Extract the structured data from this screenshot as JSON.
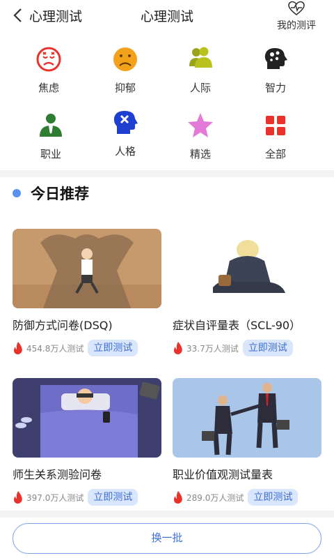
{
  "header": {
    "back_label": "心理测试",
    "title": "心理测试",
    "my_test_label": "我的测评"
  },
  "categories": [
    {
      "label": "焦虑",
      "icon": "anxious-face-icon",
      "color": "#e8322b"
    },
    {
      "label": "抑郁",
      "icon": "sad-face-icon",
      "color": "#f3a21b"
    },
    {
      "label": "人际",
      "icon": "people-icon",
      "color": "#b9c21c"
    },
    {
      "label": "智力",
      "icon": "brain-head-icon",
      "color": "#222222"
    },
    {
      "label": "职业",
      "icon": "worker-icon",
      "color": "#2e7d32"
    },
    {
      "label": "人格",
      "icon": "personality-head-icon",
      "color": "#1e3fd0"
    },
    {
      "label": "精选",
      "icon": "star-icon",
      "color": "#e37ad8"
    },
    {
      "label": "全部",
      "icon": "grid-icon",
      "color": "#e8322b"
    }
  ],
  "section": {
    "title": "今日推荐"
  },
  "recommendations": [
    {
      "title": "防御方式问卷(DSQ)",
      "count": "454.8万人测试",
      "button": "立即测试"
    },
    {
      "title": "症状自评量表（SCL-90）",
      "count": "33.7万人测试",
      "button": "立即测试"
    },
    {
      "title": "师生关系测验问卷",
      "count": "397.0万人测试",
      "button": "立即测试"
    },
    {
      "title": "职业价值观测试量表",
      "count": "289.0万人测试",
      "button": "立即测试"
    }
  ],
  "more_button": "换一批",
  "colors": {
    "accent": "#3f6fd4",
    "fire": "#e8322b"
  }
}
